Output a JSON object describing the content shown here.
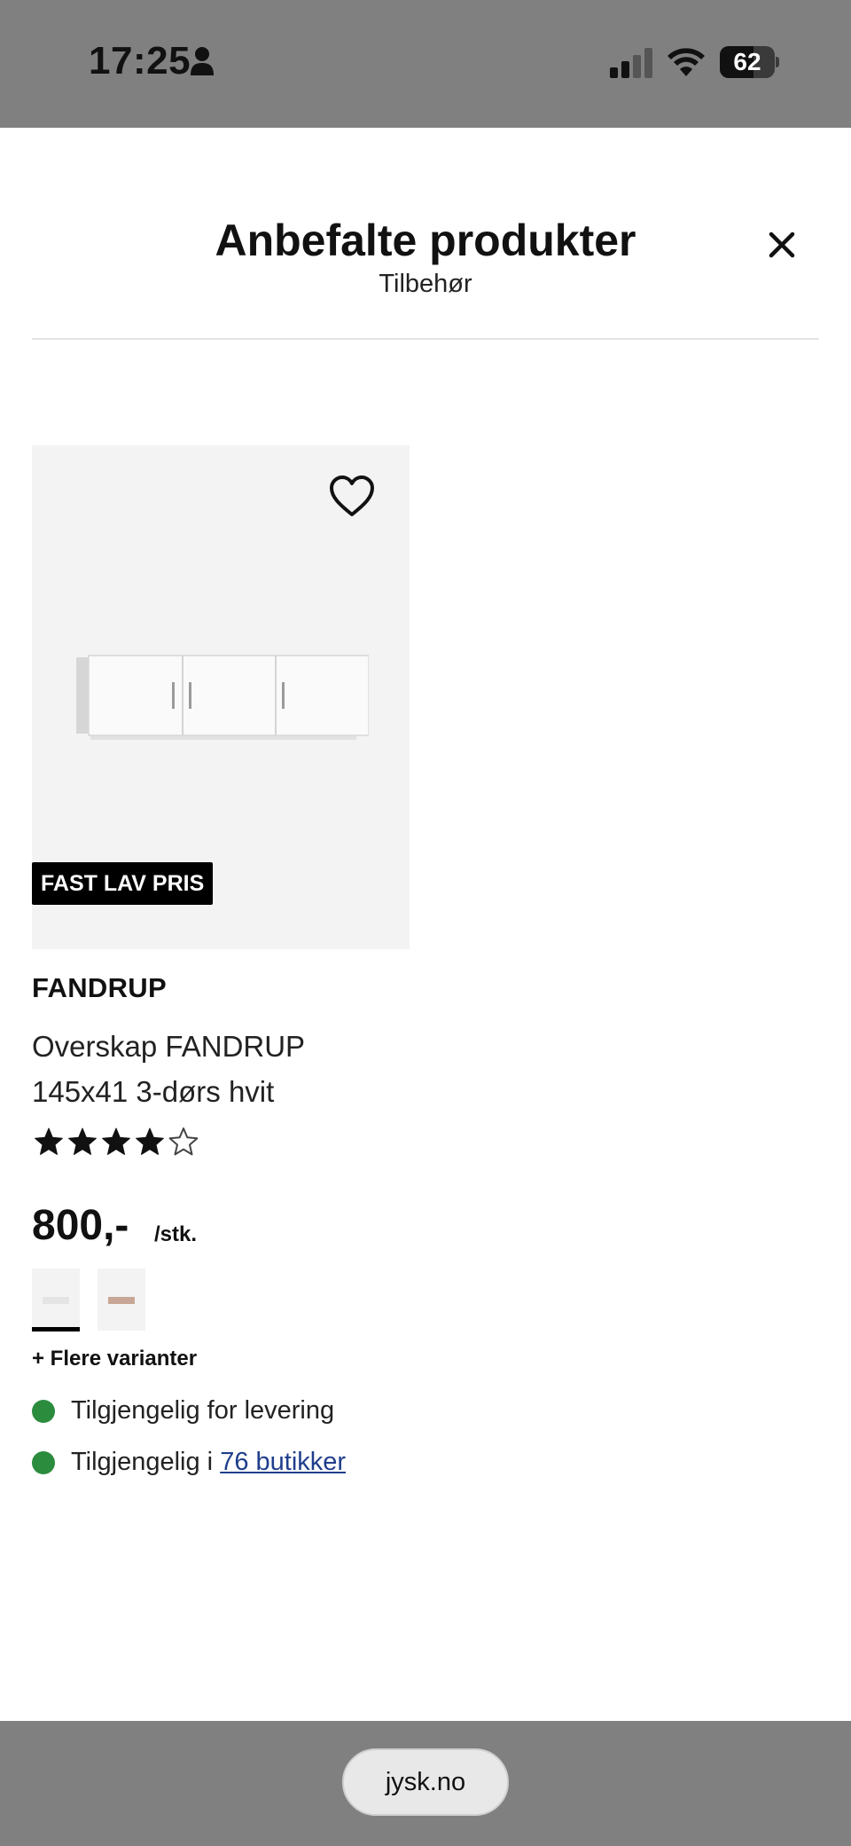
{
  "status_bar": {
    "time": "17:25",
    "battery_level": "62",
    "battery_fraction": 0.62,
    "icons": [
      "person-icon",
      "cellular-signal-icon",
      "wifi-icon",
      "battery-icon"
    ]
  },
  "modal": {
    "title": "Anbefalte produkter",
    "subtitle": "Tilbehør",
    "close_icon": "close-icon"
  },
  "product": {
    "badge": "FAST LAV PRIS",
    "brand": "FANDRUP",
    "name": "Overskap FANDRUP 145x41 3-dørs hvit",
    "rating": 4,
    "rating_max": 5,
    "price": "800,-",
    "unit": "/stk.",
    "swatches": [
      {
        "color": "#e4e4e4",
        "selected": true
      },
      {
        "color": "#c8a696",
        "selected": false
      }
    ],
    "more_variants": "+ Flere varianter",
    "availability": {
      "delivery": "Tilgjengelig for levering",
      "stores_prefix": "Tilgjengelig i",
      "stores_link": "76 butikker"
    },
    "colors": {
      "available_dot": "#2b8c3e",
      "link": "#1f3e8c",
      "badge_bg": "#000000"
    }
  },
  "browser": {
    "url": "jysk.no"
  }
}
